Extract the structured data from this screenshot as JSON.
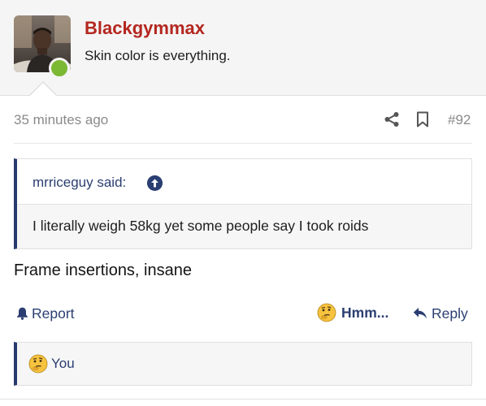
{
  "post": {
    "username": "Blackgymmax",
    "user_title": "Skin color is everything.",
    "timestamp": "35 minutes ago",
    "post_number": "#92",
    "body": "Frame insertions, insane"
  },
  "quote": {
    "author": "mrriceguy said:",
    "text": "I literally weigh 58kg yet some people say I took roids"
  },
  "actions": {
    "report": "Report",
    "reaction": "Hmm...",
    "reply": "Reply"
  },
  "reactions": {
    "summary": "You"
  },
  "colors": {
    "username": "#b4271f",
    "link": "#2b3e72",
    "online": "#7bb833",
    "quote_border": "#283a6e"
  },
  "icons": [
    "share-icon",
    "bookmark-icon",
    "goto-arrow-icon",
    "bell-icon",
    "thinking-emoji-icon",
    "reply-arrow-icon"
  ]
}
